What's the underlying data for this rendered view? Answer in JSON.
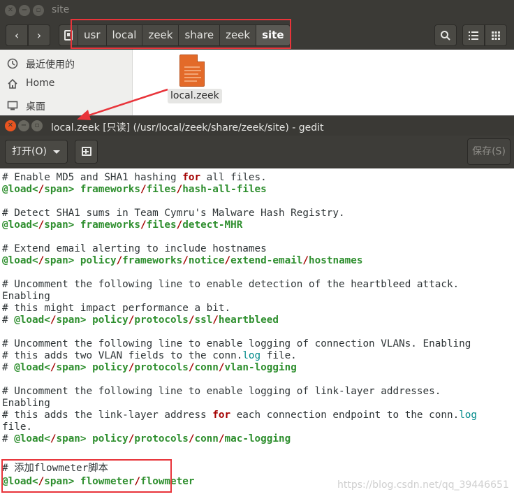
{
  "file_manager": {
    "title": "site",
    "path": [
      "usr",
      "local",
      "zeek",
      "share",
      "zeek",
      "site"
    ],
    "sidebar": [
      {
        "icon": "clock-icon",
        "label": "最近使用的"
      },
      {
        "icon": "home-icon",
        "label": "Home"
      },
      {
        "icon": "desktop-icon",
        "label": "桌面"
      }
    ],
    "file": {
      "name": "local.zeek",
      "icon": "text-document-icon"
    }
  },
  "editor_window": {
    "title": "local.zeek [只读] (/usr/local/zeek/share/zeek/site) - gedit",
    "open_label": "打开(O)",
    "save_label": "保存(S)"
  },
  "editor_lines": [
    "# Enable MD5 and SHA1 hashing for all files.",
    "@load frameworks/files/hash-all-files",
    "",
    "# Detect SHA1 sums in Team Cymru's Malware Hash Registry.",
    "@load frameworks/files/detect-MHR",
    "",
    "# Extend email alerting to include hostnames",
    "@load policy/frameworks/notice/extend-email/hostnames",
    "",
    "# Uncomment the following line to enable detection of the heartbleed attack.",
    "Enabling",
    "# this might impact performance a bit.",
    "# @load policy/protocols/ssl/heartbleed",
    "",
    "# Uncomment the following line to enable logging of connection VLANs. Enabling",
    "# this adds two VLAN fields to the conn.log file.",
    "# @load policy/protocols/conn/vlan-logging",
    "",
    "# Uncomment the following line to enable logging of link-layer addresses.",
    "Enabling",
    "# this adds the link-layer address for each connection endpoint to the conn.log",
    "file.",
    "# @load policy/protocols/conn/mac-logging",
    "",
    "",
    "# 添加flowmeter脚本",
    "@load flowmeter/flowmeter"
  ],
  "watermark": "https://blog.csdn.net/qq_39446651",
  "colors": {
    "annotation_red": "#e8343a",
    "ubuntu_orange": "#e95420",
    "keyword": "#a40000",
    "directive": "#2f8f2f",
    "link_text": "#008a8a"
  }
}
